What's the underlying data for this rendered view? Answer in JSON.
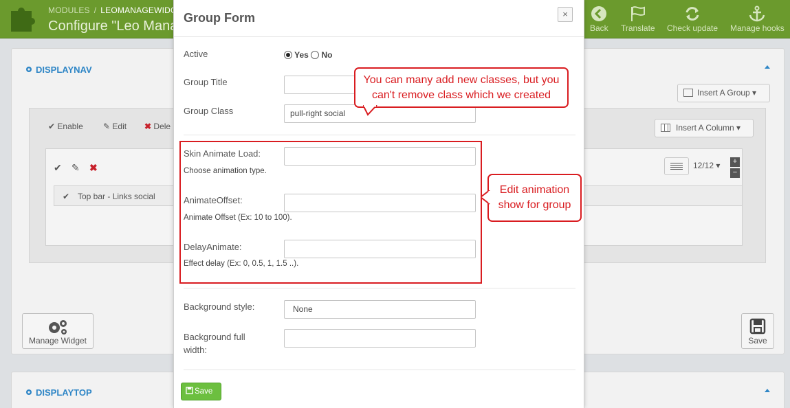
{
  "header": {
    "breadcrumb": [
      "MODULES",
      "LEOMANAGEWIDG"
    ],
    "title": "Configure \"Leo Mana",
    "toolbar": [
      {
        "label": "Back",
        "icon": "back-arrow-icon"
      },
      {
        "label": "Translate",
        "icon": "flag-icon"
      },
      {
        "label": "Check update",
        "icon": "refresh-icon"
      },
      {
        "label": "Manage hooks",
        "icon": "anchor-icon"
      }
    ]
  },
  "background": {
    "section_nav": "DISPLAYNAV",
    "section_top": "DISPLAYTOP",
    "insert_group": "Insert A Group",
    "insert_column": "Insert A Column",
    "enable": "Enable",
    "edit": "Edit",
    "delete": "Dele",
    "column_width": "12/12",
    "widget_row": "Top bar - Links social",
    "manage_widget": "Manage Widget",
    "save": "Save",
    "plus": "+",
    "minus": "−"
  },
  "modal": {
    "title": "Group Form",
    "close": "×",
    "active_label": "Active",
    "yes": "Yes",
    "no": "No",
    "group_title_label": "Group Title",
    "group_title_value": "",
    "group_class_label": "Group Class",
    "group_class_value": "pull-right social",
    "skin_animate_label": "Skin Animate Load:",
    "skin_animate_help": "Choose animation type.",
    "animate_offset_label": "AnimateOffset:",
    "animate_offset_help": "Animate Offset (Ex: 10 to 100).",
    "delay_animate_label": "DelayAnimate:",
    "delay_animate_help": "Effect delay (Ex: 0, 0.5, 1, 1.5 ..).",
    "bg_style_label": "Background style:",
    "bg_style_value": "None",
    "bg_full_label_1": "Background full",
    "bg_full_label_2": "width:",
    "save_label": "Save"
  },
  "annotations": {
    "callout_classes_1": "You can many add new classes, but you",
    "callout_classes_2": "can't remove class which we created",
    "callout_anim_1": "Edit animation",
    "callout_anim_2": "show for group"
  },
  "colors": {
    "brand_green": "#6b9a2d",
    "link_blue": "#2f86c6",
    "annotation_red": "#d91c20",
    "save_green": "#6cbf3f"
  }
}
